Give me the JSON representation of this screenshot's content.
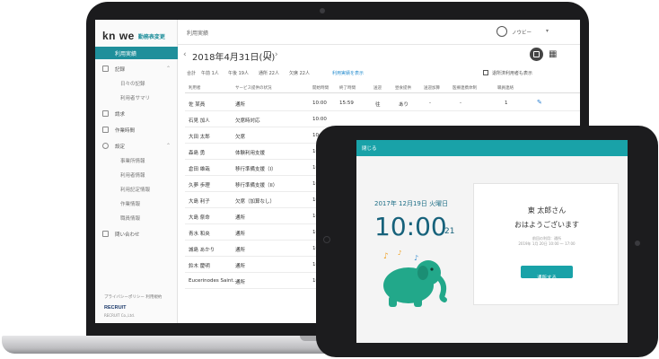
{
  "app": {
    "logo": "kn  we",
    "logo_sub": "勤務表変更",
    "breadcrumb": "利用実績"
  },
  "sidebar": {
    "active": "利用実績",
    "items": [
      {
        "label": "記録",
        "sub": false,
        "chevron": "⌃"
      },
      {
        "label": "日々の記録",
        "sub": true
      },
      {
        "label": "利用者サマリ",
        "sub": true
      },
      {
        "label": "請求",
        "sub": false
      },
      {
        "label": "作業時間",
        "sub": false
      },
      {
        "label": "設定",
        "sub": false,
        "chevron": "⌃"
      },
      {
        "label": "事業所情報",
        "sub": true
      },
      {
        "label": "利用者情報",
        "sub": true
      },
      {
        "label": "利用記定情報",
        "sub": true
      },
      {
        "label": "作業情報",
        "sub": true
      },
      {
        "label": "職員情報",
        "sub": true
      },
      {
        "label": "問い合わせ",
        "sub": false
      }
    ],
    "footer_text": "プライバシーポリシー  利用規約",
    "brand": "RECRUIT",
    "brand_sub": "RECRUIT Co.,Ltd."
  },
  "topbar": {
    "user_name": "ノウビー"
  },
  "datebar": {
    "date": "2018年4月31日(火)"
  },
  "summary": {
    "items": [
      "合計",
      "午前 1人",
      "午後 19人",
      "通所 22人",
      "欠席 22人"
    ],
    "link": "利用実績を表示",
    "checkbox_label": "退所済利用者も表示"
  },
  "table": {
    "headers": [
      "利用者",
      "サービス提供の状況",
      "開始時間",
      "終了時間",
      "送迎",
      "昼食提供",
      "送迎加算",
      "医療連携体制",
      "職員連絡"
    ],
    "rows": [
      [
        "佐 某員",
        "通所",
        "10:00",
        "15:59",
        "往",
        "あり",
        "-",
        "-",
        "1"
      ],
      [
        "石見 加人",
        "欠席時対応",
        "10:00"
      ],
      [
        "大田 太郎",
        "欠席",
        "10:00"
      ],
      [
        "森島 勇",
        "体験利用支援",
        "10:00"
      ],
      [
        "倉田 雄哉",
        "移行準備支援（I）",
        "10:00"
      ],
      [
        "久夢 歩理",
        "移行準備支援（II）",
        "10:00"
      ],
      [
        "大島 利子",
        "欠席（加算なし）",
        "10:00"
      ],
      [
        "大島 祭命",
        "通所",
        "10:00"
      ],
      [
        "青水 和央",
        "通所",
        "10:00"
      ],
      [
        "城島 あかり",
        "通所",
        "10:00"
      ],
      [
        "鈴木 慶明",
        "通所",
        "10:00"
      ],
      [
        "Eucerinodes Saint…",
        "通所",
        "10:00"
      ]
    ]
  },
  "tablet": {
    "header": "閉じる",
    "date": "2017年 12月19日 火曜日",
    "time": "10:00",
    "seconds": "21",
    "name": "東 太郎さん",
    "greeting": "おはようございます",
    "info1": "前回の利用：通所",
    "info2": "2019年 1月 20日 10:00 〜 17:00",
    "button": "通所する"
  },
  "colors": {
    "accent": "#19a2a8",
    "sidebar_active": "#1f8f9b",
    "clock": "#17627b",
    "elephant": "#22a88a"
  }
}
